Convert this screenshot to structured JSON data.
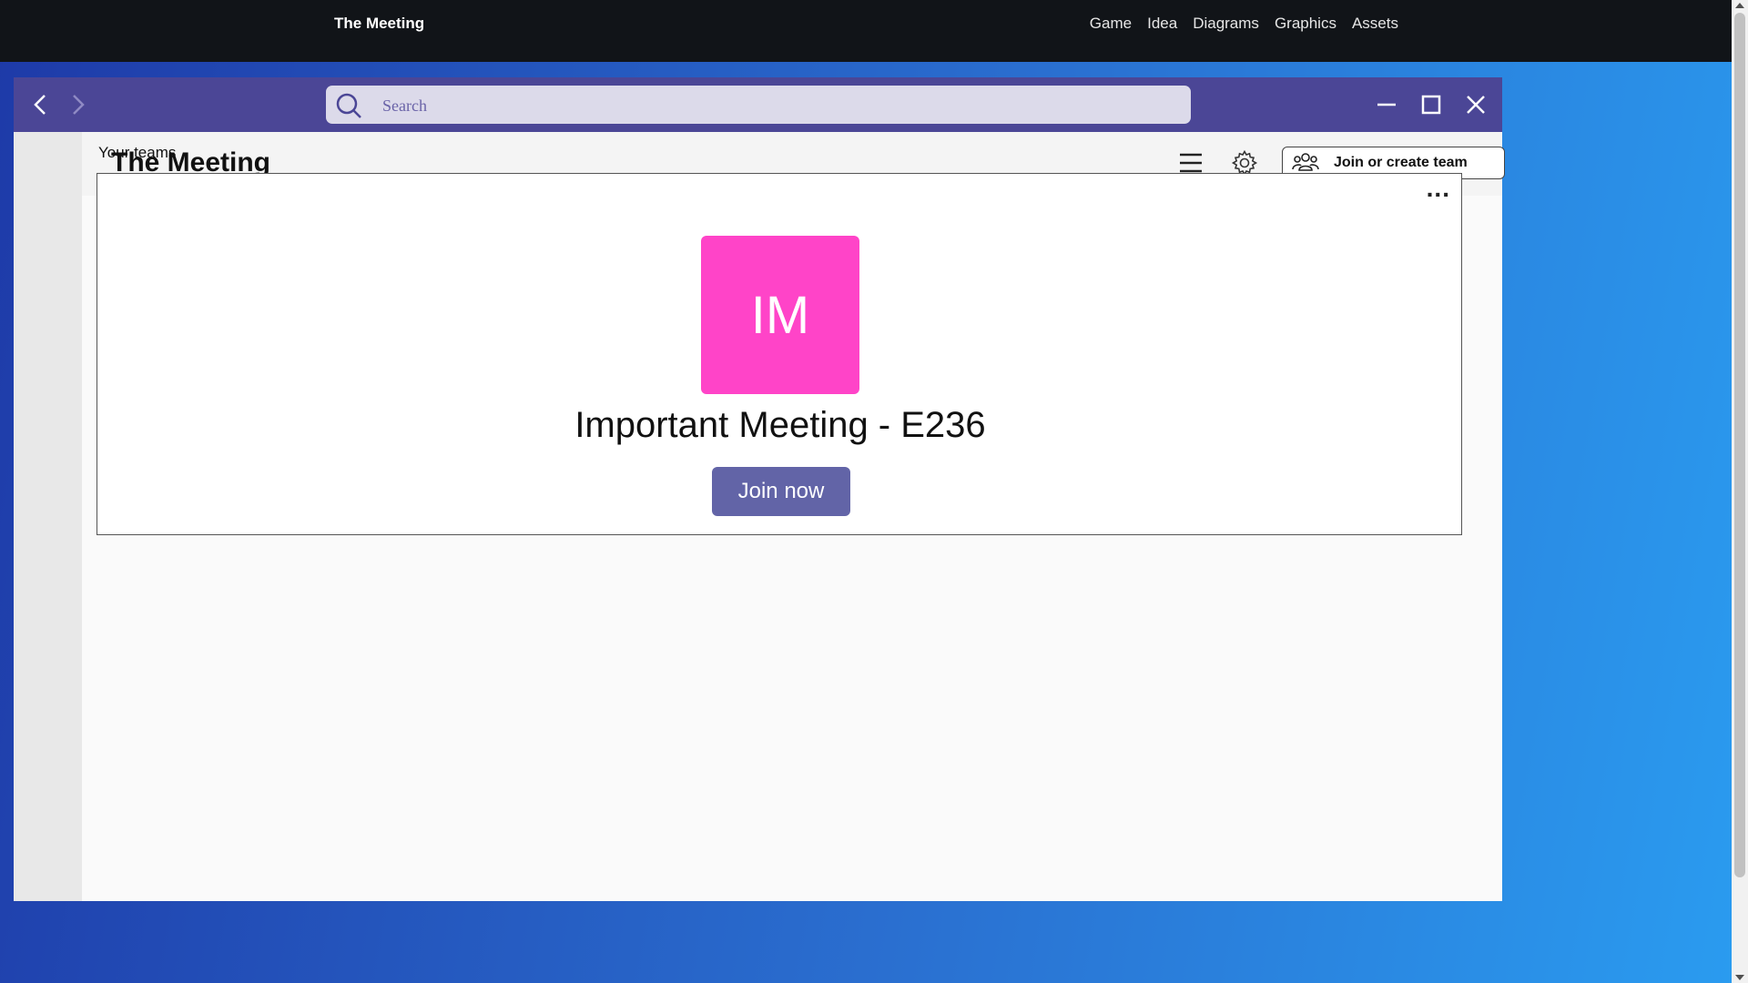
{
  "site": {
    "title": "The Meeting",
    "links": [
      "Game",
      "Idea",
      "Diagrams",
      "Graphics",
      "Assets"
    ]
  },
  "titlebar": {
    "search_placeholder": "Search"
  },
  "header": {
    "title": "The Meeting",
    "join_create_label": "Join or create team"
  },
  "teams": {
    "section_label": "Your teams",
    "more_label": "...",
    "card": {
      "initials": "IM",
      "name": "Important Meeting - E236",
      "join_label": "Join now"
    }
  },
  "colors": {
    "titlebar": "#4b4696",
    "avatar": "#ff44c8",
    "join_button": "#6264a7"
  }
}
